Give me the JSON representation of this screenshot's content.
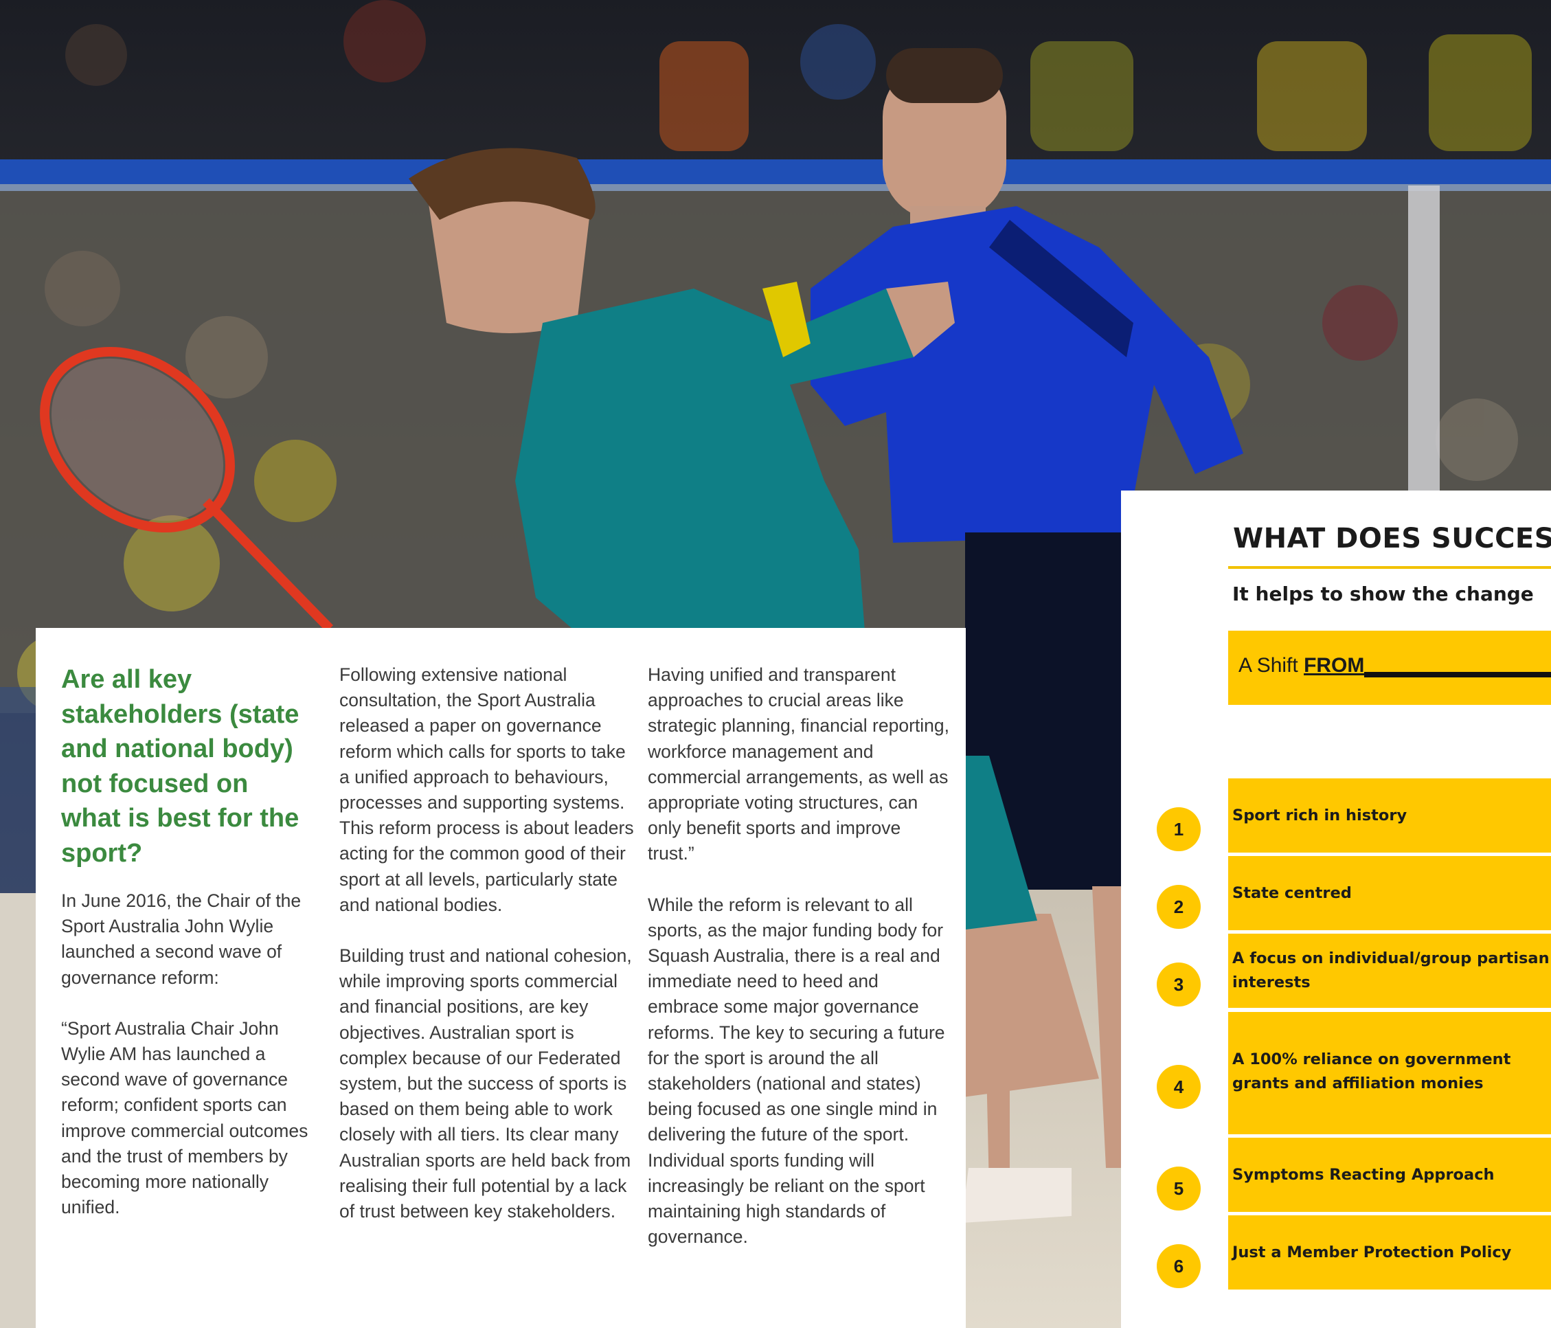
{
  "article": {
    "headline": "Are all key\nstakeholders (state\nand national body)\nnot focused on\nwhat is best for the\nsport?",
    "col1_p1": "In June 2016, the Chair of the Sport Australia John Wylie launched a second wave of governance reform:",
    "col1_p2": "“Sport Australia Chair John Wylie AM has launched a second wave of governance reform; confident sports can improve commercial outcomes and the trust of members by becoming more nationally unified.",
    "col2_p1": "Following extensive national consultation, the Sport Australia released a paper on governance reform which calls for sports to take a unified approach to behaviours, processes and supporting systems. This reform process is about leaders acting for the common good of their sport at all levels, particularly state and national bodies.",
    "col2_p2": "Building trust and national cohesion, while improving sports commercial and financial positions, are key objectives. Australian sport is complex because of our Federated system, but the success of sports is based on them being able to work closely with all tiers. Its clear many Australian sports are held back from realising their full potential by a lack of trust between key stakeholders.",
    "col3_p1": "Having unified and transparent approaches to crucial areas like strategic planning, financial reporting, workforce management and commercial arrangements, as well as appropriate voting structures, can only benefit sports and improve trust.”",
    "col3_p2": "While the reform is relevant to all sports, as the major funding body for Squash Australia, there is a real and immediate need to heed and embrace some major governance reforms. The key to securing a future for the sport is around the all stakeholders (national and states) being focused as one single mind in delivering the future of the sport. Individual sports funding will increasingly be reliant on the sport maintaining high standards of governance."
  },
  "success": {
    "title": "WHAT DOES SUCCESS",
    "subtitle": "It helps to show the change",
    "shift_prefix": "A Shift ",
    "shift_from": "FROM",
    "items": [
      {
        "num": "1",
        "text": "Sport rich in history"
      },
      {
        "num": "2",
        "text": "State centred"
      },
      {
        "num": "3",
        "text": "A focus on individual/group partisan interests"
      },
      {
        "num": "4",
        "text": "A 100% reliance on government grants and affiliation monies"
      },
      {
        "num": "5",
        "text": "Symptoms Reacting Approach"
      },
      {
        "num": "6",
        "text": "Just a Member Protection Policy"
      }
    ]
  },
  "colors": {
    "headline_green": "#3b8a3f",
    "accent_yellow": "#ffc800",
    "player1_shirt": "#0f7f86",
    "player2_shirt": "#1638c8"
  }
}
